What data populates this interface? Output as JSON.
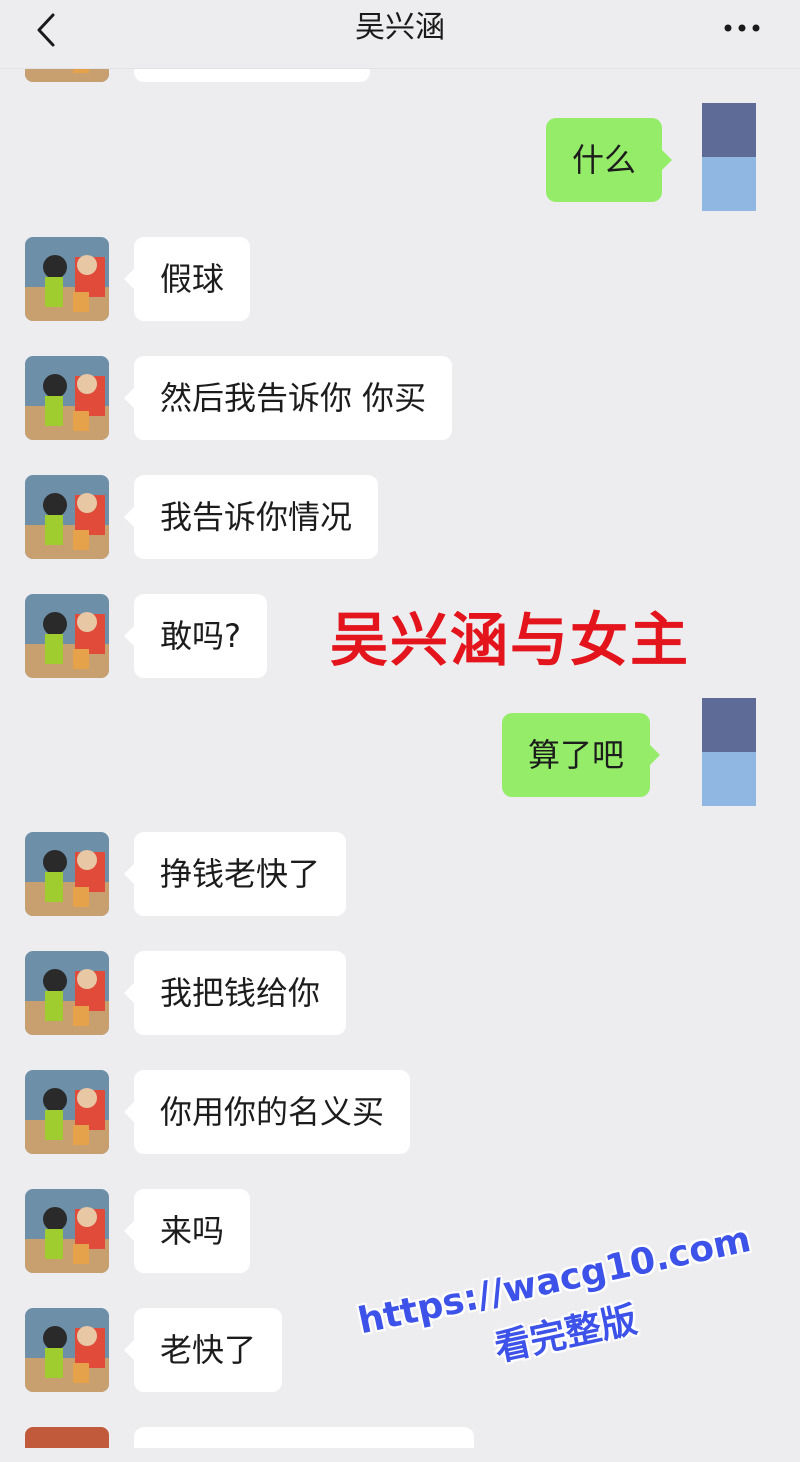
{
  "header": {
    "title": "吴兴涵",
    "back_icon": "chevron-left-icon",
    "more_icon": "more-dots-icon"
  },
  "messages": [
    {
      "side": "right",
      "text": "什么"
    },
    {
      "side": "left",
      "text": "假球"
    },
    {
      "side": "left",
      "text": "然后我告诉你 你买"
    },
    {
      "side": "left",
      "text": "我告诉你情况"
    },
    {
      "side": "left",
      "text": "敢吗?"
    },
    {
      "side": "right",
      "text": "算了吧"
    },
    {
      "side": "left",
      "text": "挣钱老快了"
    },
    {
      "side": "left",
      "text": "我把钱给你"
    },
    {
      "side": "left",
      "text": "你用你的名义买"
    },
    {
      "side": "left",
      "text": "来吗"
    },
    {
      "side": "left",
      "text": "老快了"
    }
  ],
  "overlay": {
    "caption": "吴兴涵与女主"
  },
  "watermark": {
    "url": "https://wacg10.com",
    "sub": "看完整版"
  },
  "colors": {
    "background": "#ededf0",
    "bubble_self": "#95ec69",
    "bubble_other": "#ffffff",
    "caption": "#e3141b",
    "watermark": "#3d52e8"
  }
}
